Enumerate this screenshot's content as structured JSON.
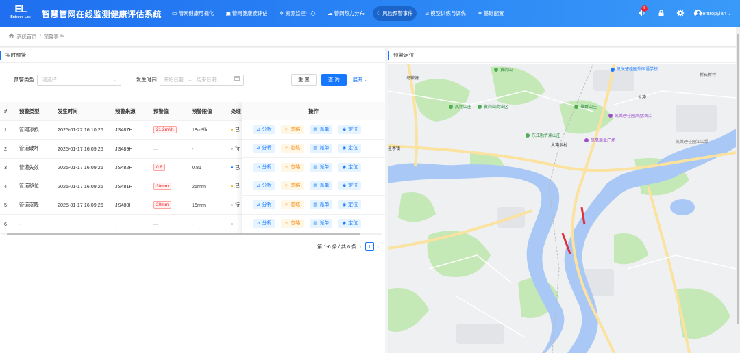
{
  "header": {
    "logo_mark": "EL",
    "logo_text": "Entropy Lan",
    "system_title": "智慧管网在线监测健康评估系统",
    "nav": [
      {
        "label": "管网健康可视化",
        "icon": "monitor-icon",
        "glyph": "▭",
        "active": false
      },
      {
        "label": "管网健康度评估",
        "icon": "briefcase-icon",
        "glyph": "▣",
        "active": false
      },
      {
        "label": "资源监控中心",
        "icon": "gear-icon",
        "glyph": "✲",
        "active": false
      },
      {
        "label": "管网热力分布",
        "icon": "cloud-icon",
        "glyph": "☁",
        "active": false
      },
      {
        "label": "风险预警事件",
        "icon": "bell-icon",
        "glyph": "♢",
        "active": true
      },
      {
        "label": "模型训练与调优",
        "icon": "chart-icon",
        "glyph": "⊿",
        "active": false
      },
      {
        "label": "基础配置",
        "icon": "settings-icon",
        "glyph": "✲",
        "active": false
      }
    ],
    "notification_count": "5",
    "username": "entropylan"
  },
  "breadcrumb": {
    "home": "系统首页",
    "separator": "/",
    "current": "预警事件"
  },
  "left_panel": {
    "title": "实时预警",
    "filters": {
      "type_label": "预警类型:",
      "type_placeholder": "请选择",
      "time_label": "发生时间:",
      "start_placeholder": "开始日期",
      "end_placeholder": "结束日期",
      "reset": "重 置",
      "search": "查 询",
      "expand": "展开"
    },
    "table": {
      "columns": [
        "#",
        "预警类型",
        "发生时间",
        "预警来源",
        "预警值",
        "预警限值",
        "处理"
      ],
      "ops_header": "操作",
      "rows": [
        {
          "idx": "1",
          "type": "管网渗损",
          "time": "2025-01-22 16:10:26",
          "source": "JS487H",
          "value": "21.2m³/h",
          "value_tag": true,
          "limit": "18m³/h",
          "status": "已",
          "status_color": "#faad14"
        },
        {
          "idx": "2",
          "type": "管道破坏",
          "time": "2025-01-17 16:09:26",
          "source": "JS489H",
          "value": "—",
          "value_tag": false,
          "limit": "-",
          "status": "待",
          "status_color": "#bfbfbf"
        },
        {
          "idx": "3",
          "type": "管道失效",
          "time": "2025-01-17 16:09:26",
          "source": "JS482H",
          "value": "0.8",
          "value_tag": true,
          "limit": "0.81",
          "status": "已",
          "status_color": "#1677ff"
        },
        {
          "idx": "4",
          "type": "管道移位",
          "time": "2025-01-17 16:09:26",
          "source": "JS481H",
          "value": "30mm",
          "value_tag": true,
          "limit": "25mm",
          "status": "已",
          "status_color": "#faad14"
        },
        {
          "idx": "5",
          "type": "管道沉降",
          "time": "2025-01-17 16:09:26",
          "source": "JS480H",
          "value": "20mm",
          "value_tag": true,
          "limit": "15mm",
          "status": "待",
          "status_color": "#bfbfbf"
        },
        {
          "idx": "6",
          "type": "-",
          "time": "",
          "source": "-",
          "value": "—",
          "value_tag": false,
          "limit": "-",
          "status": "",
          "status_color": "#bfbfbf"
        }
      ],
      "ops": {
        "analyze": "分析",
        "ignore": "忽略",
        "dispatch": "派单",
        "locate": "定位"
      }
    },
    "pagination": {
      "summary": "第 1-6 条 / 共 6 条",
      "current_page": "1"
    }
  },
  "right_panel": {
    "title": "预警定位",
    "map_labels": {
      "l1": "黄岗山",
      "l2": "凯关碧桂园外国语学校",
      "l3": "新石新村",
      "l4": "马鞍塘",
      "l5": "凤翔山庄",
      "l6": "黄岗山商业区",
      "l7": "雄群山庄",
      "l8": "凯关碧桂园凤凰酒店",
      "l9": "火冲",
      "l10": "东江融侨澜山庄",
      "l11": "大冲坂村",
      "l12": "凤凰商业广场",
      "l13": "星亭镇",
      "l14": "凯关碧桂园江山绿"
    }
  },
  "colors": {
    "primary": "#1677ff",
    "header_start": "#1f6ff0",
    "danger": "#f5222d",
    "warning": "#fa8c16",
    "river": "#aac8f5",
    "park": "#c5e8b7",
    "road": "#fbe29f"
  }
}
